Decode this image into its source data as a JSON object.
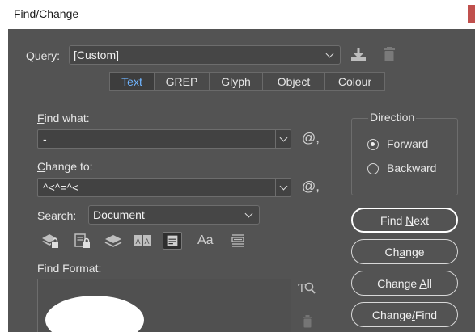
{
  "window": {
    "title": "Find/Change"
  },
  "query": {
    "label": "Query:",
    "accesskey": "Q",
    "label_rest": "uery:",
    "value": "[Custom]"
  },
  "tabs": [
    {
      "label": "Text",
      "active": true
    },
    {
      "label": "GREP",
      "active": false
    },
    {
      "label": "Glyph",
      "active": false
    },
    {
      "label": "Object",
      "active": false
    },
    {
      "label": "Colour",
      "active": false
    }
  ],
  "find_what": {
    "label_key": "F",
    "label_rest": "ind what:",
    "value": "-",
    "special_char_icon": "@,"
  },
  "change_to": {
    "label_key": "C",
    "label_rest": "hange to:",
    "value": "^<^=^<",
    "special_char_icon": "@,"
  },
  "search": {
    "label_key": "S",
    "label_rest": "earch:",
    "value": "Document"
  },
  "direction": {
    "title": "Direction",
    "options": [
      {
        "label": "Forward",
        "checked": true
      },
      {
        "label": "Backward",
        "checked": false
      }
    ]
  },
  "buttons": {
    "find_next": {
      "pre": "Find ",
      "key": "N",
      "post": "ext"
    },
    "change": {
      "pre": "Ch",
      "key": "a",
      "post": "nge"
    },
    "change_all": {
      "pre": "Change ",
      "key": "A",
      "post": "ll"
    },
    "change_find": {
      "pre": "Change",
      "key": "/",
      "post": "Find"
    }
  },
  "find_format": {
    "label": "Find Format:"
  },
  "search_option_icons": [
    "locked-layers-icon",
    "locked-stories-icon",
    "hidden-layers-icon",
    "master-pages-icon",
    "footnotes-icon",
    "case-sensitive-icon",
    "whole-word-icon"
  ],
  "case_icon_text": "Aa",
  "colors": {
    "panel": "#535353",
    "accent_tab": "#6fb4ff",
    "title_accent": "#c0504d"
  }
}
